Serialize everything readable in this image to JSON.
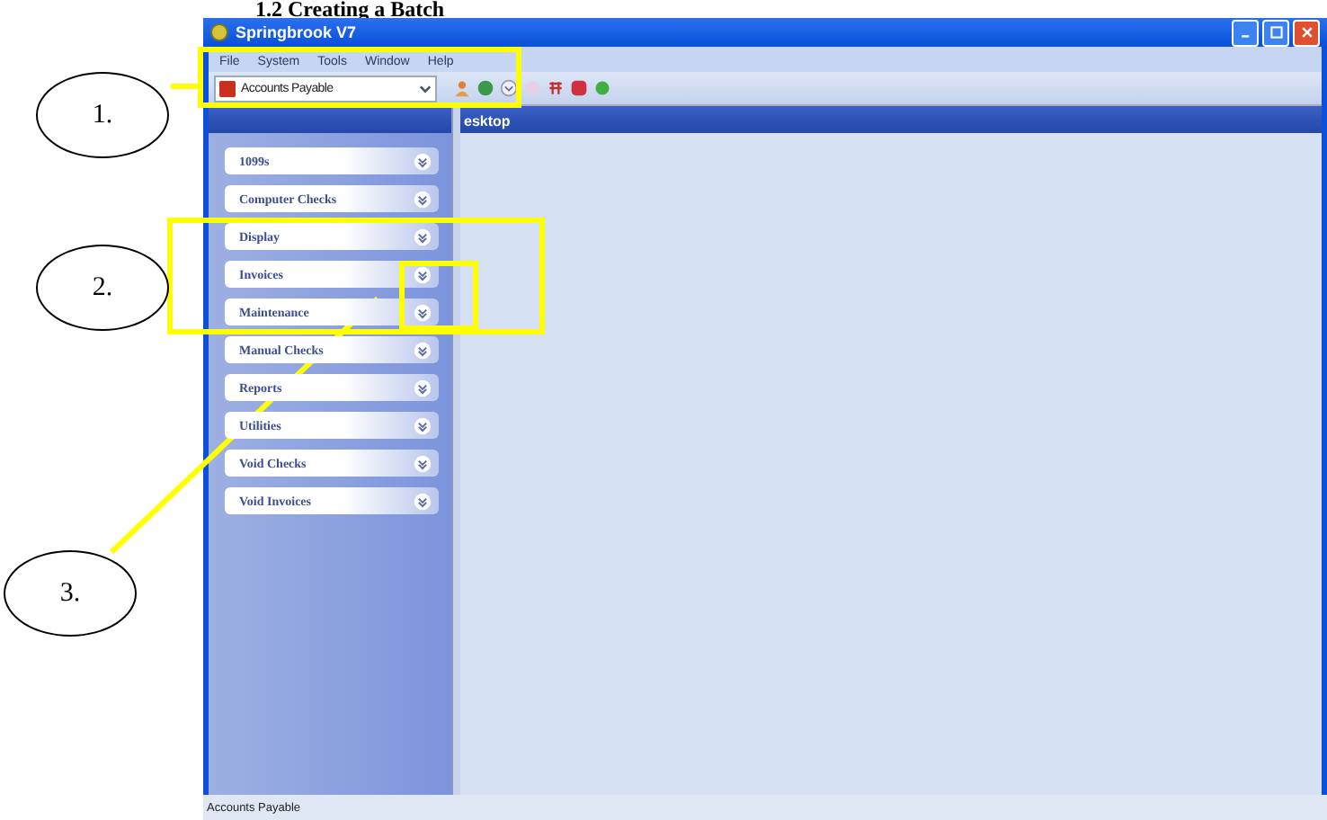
{
  "heading": "1.2 Creating a Batch",
  "window": {
    "title": "Springbrook V7"
  },
  "menu": [
    "File",
    "System",
    "Tools",
    "Window",
    "Help"
  ],
  "toolbar": {
    "module_select": "Accounts Payable"
  },
  "desktop_tab": "esktop",
  "sidebar": {
    "items": [
      {
        "label": "1099s"
      },
      {
        "label": "Computer Checks"
      },
      {
        "label": "Display"
      },
      {
        "label": "Invoices"
      },
      {
        "label": "Maintenance"
      },
      {
        "label": "Manual Checks"
      },
      {
        "label": "Reports"
      },
      {
        "label": "Utilities"
      },
      {
        "label": "Void Checks"
      },
      {
        "label": "Void Invoices"
      }
    ]
  },
  "status_bar": "Accounts Payable",
  "callouts": [
    "1.",
    "2.",
    "3."
  ]
}
